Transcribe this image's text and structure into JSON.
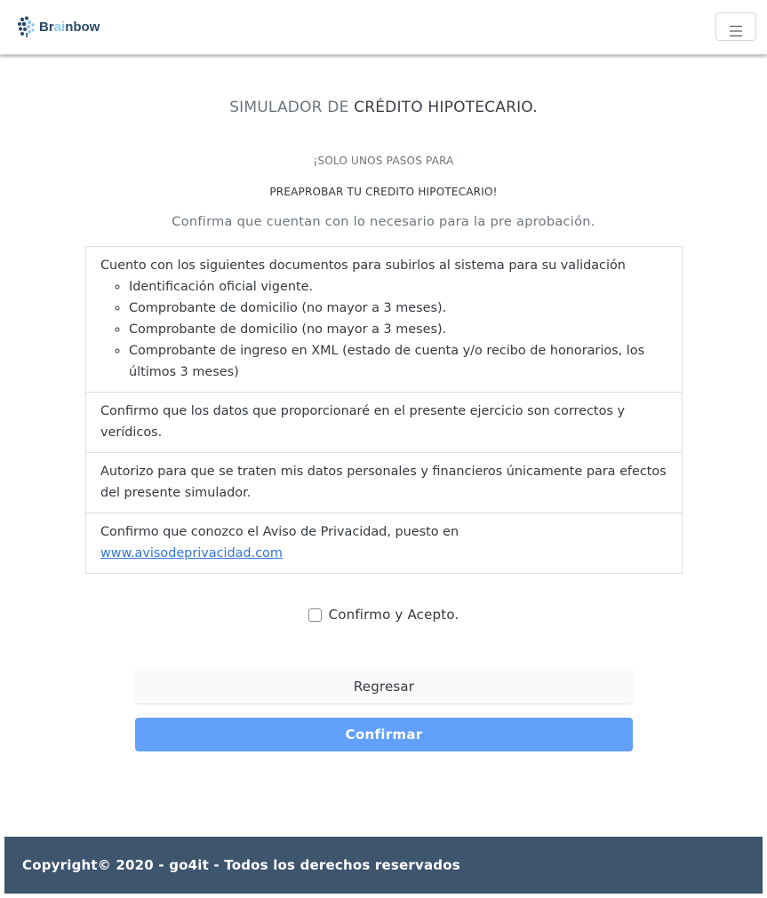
{
  "brand": {
    "logo_prefix": "Br",
    "logo_highlight": "ai",
    "logo_suffix": "nbow"
  },
  "navbar": {
    "menu_icon": "hamburger-menu-icon"
  },
  "header": {
    "title_prefix": "SIMULADOR DE ",
    "title_accent": "CRÉDITO HIPOTECARIO.",
    "subtitle_line1": "¡SOLO UNOS PASOS PARA",
    "subtitle_line2": "PREAPROBAR TU CREDITO HIPOTECARIO!",
    "intro": "Confirma que cuentan con lo necesario para la pre aprobación."
  },
  "requirements": {
    "documents_intro": "Cuento con los siguientes documentos para subirlos al sistema para su validación",
    "documents": [
      "Identificación oficial vigente.",
      "Comprobante de domicilio (no mayor a 3 meses).",
      "Comprobante de domicilio (no mayor a 3 meses).",
      "Comprobante de ingreso en XML (estado de cuenta y/o recibo de honorarios, los últimos 3 meses)"
    ],
    "data_truth": "Confirmo que los datos que proporcionaré en el presente ejercicio son correctos y verídicos.",
    "data_authorization": "Autorizo para que se traten mis datos personales y financieros únicamente para efectos del presente simulador.",
    "privacy_text": "Confirmo que conozco el Aviso de Privacidad, puesto en",
    "privacy_link": "www.avisodeprivacidad.com"
  },
  "form": {
    "checkbox_label": "Confirmo y Acepto.",
    "checkbox_checked": false,
    "back_label": "Regresar",
    "confirm_label": "Confirmar"
  },
  "footer": {
    "copyright": "Copyright© 2020 - go4it - Todos los derechos reservados"
  },
  "colors": {
    "primary_button": "#61a0fb",
    "footer_bg": "#3e556e",
    "link": "#3273dc"
  }
}
